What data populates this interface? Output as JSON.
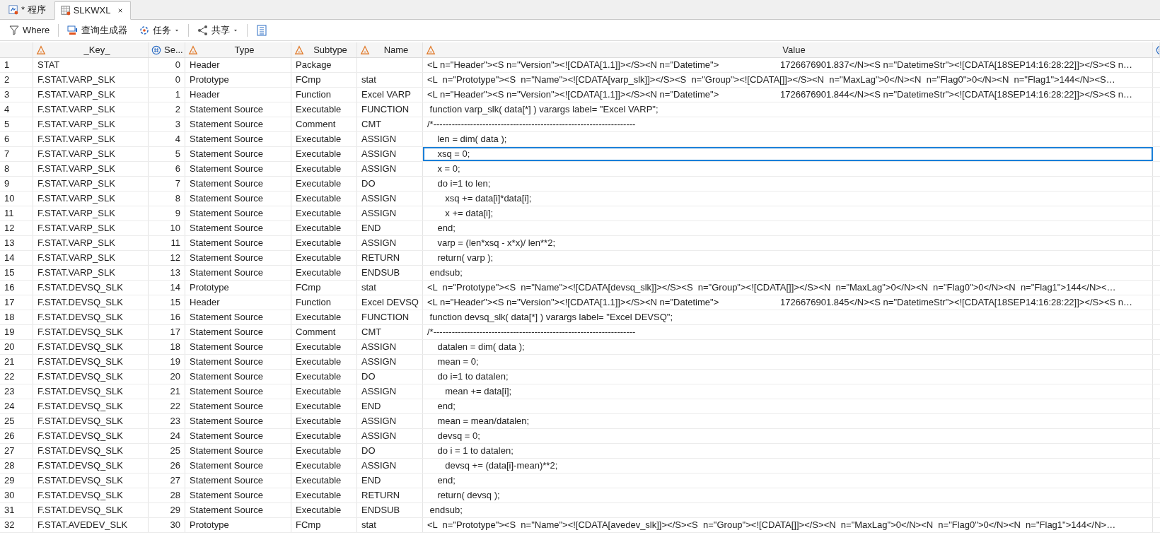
{
  "tabs": [
    {
      "label": "* 程序",
      "kind": "program",
      "selected": false,
      "closable": false
    },
    {
      "label": "SLKWXL",
      "kind": "table",
      "selected": true,
      "closable": true
    }
  ],
  "toolbar": [
    {
      "label": "Where",
      "kind": "filter",
      "dropdown": false
    },
    {
      "label": "查询生成器",
      "kind": "query",
      "dropdown": false
    },
    {
      "label": "任务",
      "kind": "tasks",
      "dropdown": true
    },
    {
      "label": "共享",
      "kind": "share",
      "dropdown": true
    },
    {
      "kind": "grid",
      "dropdown": false
    }
  ],
  "table": {
    "columns": [
      {
        "label": "_Key_",
        "kind": "char"
      },
      {
        "label": "Se...",
        "kind": "num"
      },
      {
        "label": "Type",
        "kind": "char"
      },
      {
        "label": "Subtype",
        "kind": "char"
      },
      {
        "label": "Name",
        "kind": "char"
      },
      {
        "label": "Value",
        "kind": "char"
      },
      {
        "kind": "num"
      }
    ],
    "rows": [
      {
        "n": "1",
        "cells": [
          "STAT",
          "0",
          "Header",
          "Package",
          "",
          "<L n=\"Header\"><S n=\"Version\"><![CDATA[1.1]]></S><N n=\"Datetime\">                        1726676901.837</N><S n=\"DatetimeStr\"><![CDATA[18SEP14:16:28:22]]></S><S n…"
        ],
        "selected": false
      },
      {
        "n": "2",
        "cells": [
          "F.STAT.VARP_SLK",
          "0",
          "Prototype",
          "FCmp",
          "stat",
          "<L  n=\"Prototype\"><S  n=\"Name\"><![CDATA[varp_slk]]></S><S  n=\"Group\"><![CDATA[]]></S><N  n=\"MaxLag\">0</N><N  n=\"Flag0\">0</N><N  n=\"Flag1\">144</N><S…"
        ],
        "selected": false
      },
      {
        "n": "3",
        "cells": [
          "F.STAT.VARP_SLK",
          "1",
          "Header",
          "Function",
          "Excel VARP",
          "<L n=\"Header\"><S n=\"Version\"><![CDATA[1.1]]></S><N n=\"Datetime\">                        1726676901.844</N><S n=\"DatetimeStr\"><![CDATA[18SEP14:16:28:22]]></S><S n…"
        ],
        "selected": false
      },
      {
        "n": "4",
        "cells": [
          "F.STAT.VARP_SLK",
          "2",
          "Statement Source",
          "Executable",
          "FUNCTION",
          " function varp_slk( data[*] ) varargs label= \"Excel VARP\";"
        ],
        "selected": false
      },
      {
        "n": "5",
        "cells": [
          "F.STAT.VARP_SLK",
          "3",
          "Statement Source",
          "Comment",
          "CMT",
          "/*------------------------------------------------------------------"
        ],
        "selected": false
      },
      {
        "n": "6",
        "cells": [
          "F.STAT.VARP_SLK",
          "4",
          "Statement Source",
          "Executable",
          "ASSIGN",
          "    len = dim( data );"
        ],
        "selected": false
      },
      {
        "n": "7",
        "cells": [
          "F.STAT.VARP_SLK",
          "5",
          "Statement Source",
          "Executable",
          "ASSIGN",
          "    xsq = 0;"
        ],
        "selected": true
      },
      {
        "n": "8",
        "cells": [
          "F.STAT.VARP_SLK",
          "6",
          "Statement Source",
          "Executable",
          "ASSIGN",
          "    x = 0;"
        ],
        "selected": false
      },
      {
        "n": "9",
        "cells": [
          "F.STAT.VARP_SLK",
          "7",
          "Statement Source",
          "Executable",
          "DO",
          "    do i=1 to len;"
        ],
        "selected": false
      },
      {
        "n": "10",
        "cells": [
          "F.STAT.VARP_SLK",
          "8",
          "Statement Source",
          "Executable",
          "ASSIGN",
          "       xsq += data[i]*data[i];"
        ],
        "selected": false
      },
      {
        "n": "11",
        "cells": [
          "F.STAT.VARP_SLK",
          "9",
          "Statement Source",
          "Executable",
          "ASSIGN",
          "       x += data[i];"
        ],
        "selected": false
      },
      {
        "n": "12",
        "cells": [
          "F.STAT.VARP_SLK",
          "10",
          "Statement Source",
          "Executable",
          "END",
          "    end;"
        ],
        "selected": false
      },
      {
        "n": "13",
        "cells": [
          "F.STAT.VARP_SLK",
          "11",
          "Statement Source",
          "Executable",
          "ASSIGN",
          "    varp = (len*xsq - x*x)/ len**2;"
        ],
        "selected": false
      },
      {
        "n": "14",
        "cells": [
          "F.STAT.VARP_SLK",
          "12",
          "Statement Source",
          "Executable",
          "RETURN",
          "    return( varp );"
        ],
        "selected": false
      },
      {
        "n": "15",
        "cells": [
          "F.STAT.VARP_SLK",
          "13",
          "Statement Source",
          "Executable",
          "ENDSUB",
          " endsub;"
        ],
        "selected": false
      },
      {
        "n": "16",
        "cells": [
          "F.STAT.DEVSQ_SLK",
          "14",
          "Prototype",
          "FCmp",
          "stat",
          "<L  n=\"Prototype\"><S  n=\"Name\"><![CDATA[devsq_slk]]></S><S  n=\"Group\"><![CDATA[]]></S><N  n=\"MaxLag\">0</N><N  n=\"Flag0\">0</N><N  n=\"Flag1\">144</N><…"
        ],
        "selected": false
      },
      {
        "n": "17",
        "cells": [
          "F.STAT.DEVSQ_SLK",
          "15",
          "Header",
          "Function",
          "Excel DEVSQ",
          "<L n=\"Header\"><S n=\"Version\"><![CDATA[1.1]]></S><N n=\"Datetime\">                        1726676901.845</N><S n=\"DatetimeStr\"><![CDATA[18SEP14:16:28:22]]></S><S n…"
        ],
        "selected": false
      },
      {
        "n": "18",
        "cells": [
          "F.STAT.DEVSQ_SLK",
          "16",
          "Statement Source",
          "Executable",
          "FUNCTION",
          " function devsq_slk( data[*] ) varargs label= \"Excel DEVSQ\";"
        ],
        "selected": false
      },
      {
        "n": "19",
        "cells": [
          "F.STAT.DEVSQ_SLK",
          "17",
          "Statement Source",
          "Comment",
          "CMT",
          "/*------------------------------------------------------------------"
        ],
        "selected": false
      },
      {
        "n": "20",
        "cells": [
          "F.STAT.DEVSQ_SLK",
          "18",
          "Statement Source",
          "Executable",
          "ASSIGN",
          "    datalen = dim( data );"
        ],
        "selected": false
      },
      {
        "n": "21",
        "cells": [
          "F.STAT.DEVSQ_SLK",
          "19",
          "Statement Source",
          "Executable",
          "ASSIGN",
          "    mean = 0;"
        ],
        "selected": false
      },
      {
        "n": "22",
        "cells": [
          "F.STAT.DEVSQ_SLK",
          "20",
          "Statement Source",
          "Executable",
          "DO",
          "    do i=1 to datalen;"
        ],
        "selected": false
      },
      {
        "n": "23",
        "cells": [
          "F.STAT.DEVSQ_SLK",
          "21",
          "Statement Source",
          "Executable",
          "ASSIGN",
          "       mean += data[i];"
        ],
        "selected": false
      },
      {
        "n": "24",
        "cells": [
          "F.STAT.DEVSQ_SLK",
          "22",
          "Statement Source",
          "Executable",
          "END",
          "    end;"
        ],
        "selected": false
      },
      {
        "n": "25",
        "cells": [
          "F.STAT.DEVSQ_SLK",
          "23",
          "Statement Source",
          "Executable",
          "ASSIGN",
          "    mean = mean/datalen;"
        ],
        "selected": false
      },
      {
        "n": "26",
        "cells": [
          "F.STAT.DEVSQ_SLK",
          "24",
          "Statement Source",
          "Executable",
          "ASSIGN",
          "    devsq = 0;"
        ],
        "selected": false
      },
      {
        "n": "27",
        "cells": [
          "F.STAT.DEVSQ_SLK",
          "25",
          "Statement Source",
          "Executable",
          "DO",
          "    do i = 1 to datalen;"
        ],
        "selected": false
      },
      {
        "n": "28",
        "cells": [
          "F.STAT.DEVSQ_SLK",
          "26",
          "Statement Source",
          "Executable",
          "ASSIGN",
          "       devsq += (data[i]-mean)**2;"
        ],
        "selected": false
      },
      {
        "n": "29",
        "cells": [
          "F.STAT.DEVSQ_SLK",
          "27",
          "Statement Source",
          "Executable",
          "END",
          "    end;"
        ],
        "selected": false
      },
      {
        "n": "30",
        "cells": [
          "F.STAT.DEVSQ_SLK",
          "28",
          "Statement Source",
          "Executable",
          "RETURN",
          "    return( devsq );"
        ],
        "selected": false
      },
      {
        "n": "31",
        "cells": [
          "F.STAT.DEVSQ_SLK",
          "29",
          "Statement Source",
          "Executable",
          "ENDSUB",
          " endsub;"
        ],
        "selected": false
      },
      {
        "n": "32",
        "cells": [
          "F.STAT.AVEDEV_SLK",
          "30",
          "Prototype",
          "FCmp",
          "stat",
          "<L  n=\"Prototype\"><S  n=\"Name\"><![CDATA[avedev_slk]]></S><S  n=\"Group\"><![CDATA[]]></S><N  n=\"MaxLag\">0</N><N  n=\"Flag0\">0</N><N  n=\"Flag1\">144</N>…"
        ],
        "selected": false
      }
    ]
  }
}
